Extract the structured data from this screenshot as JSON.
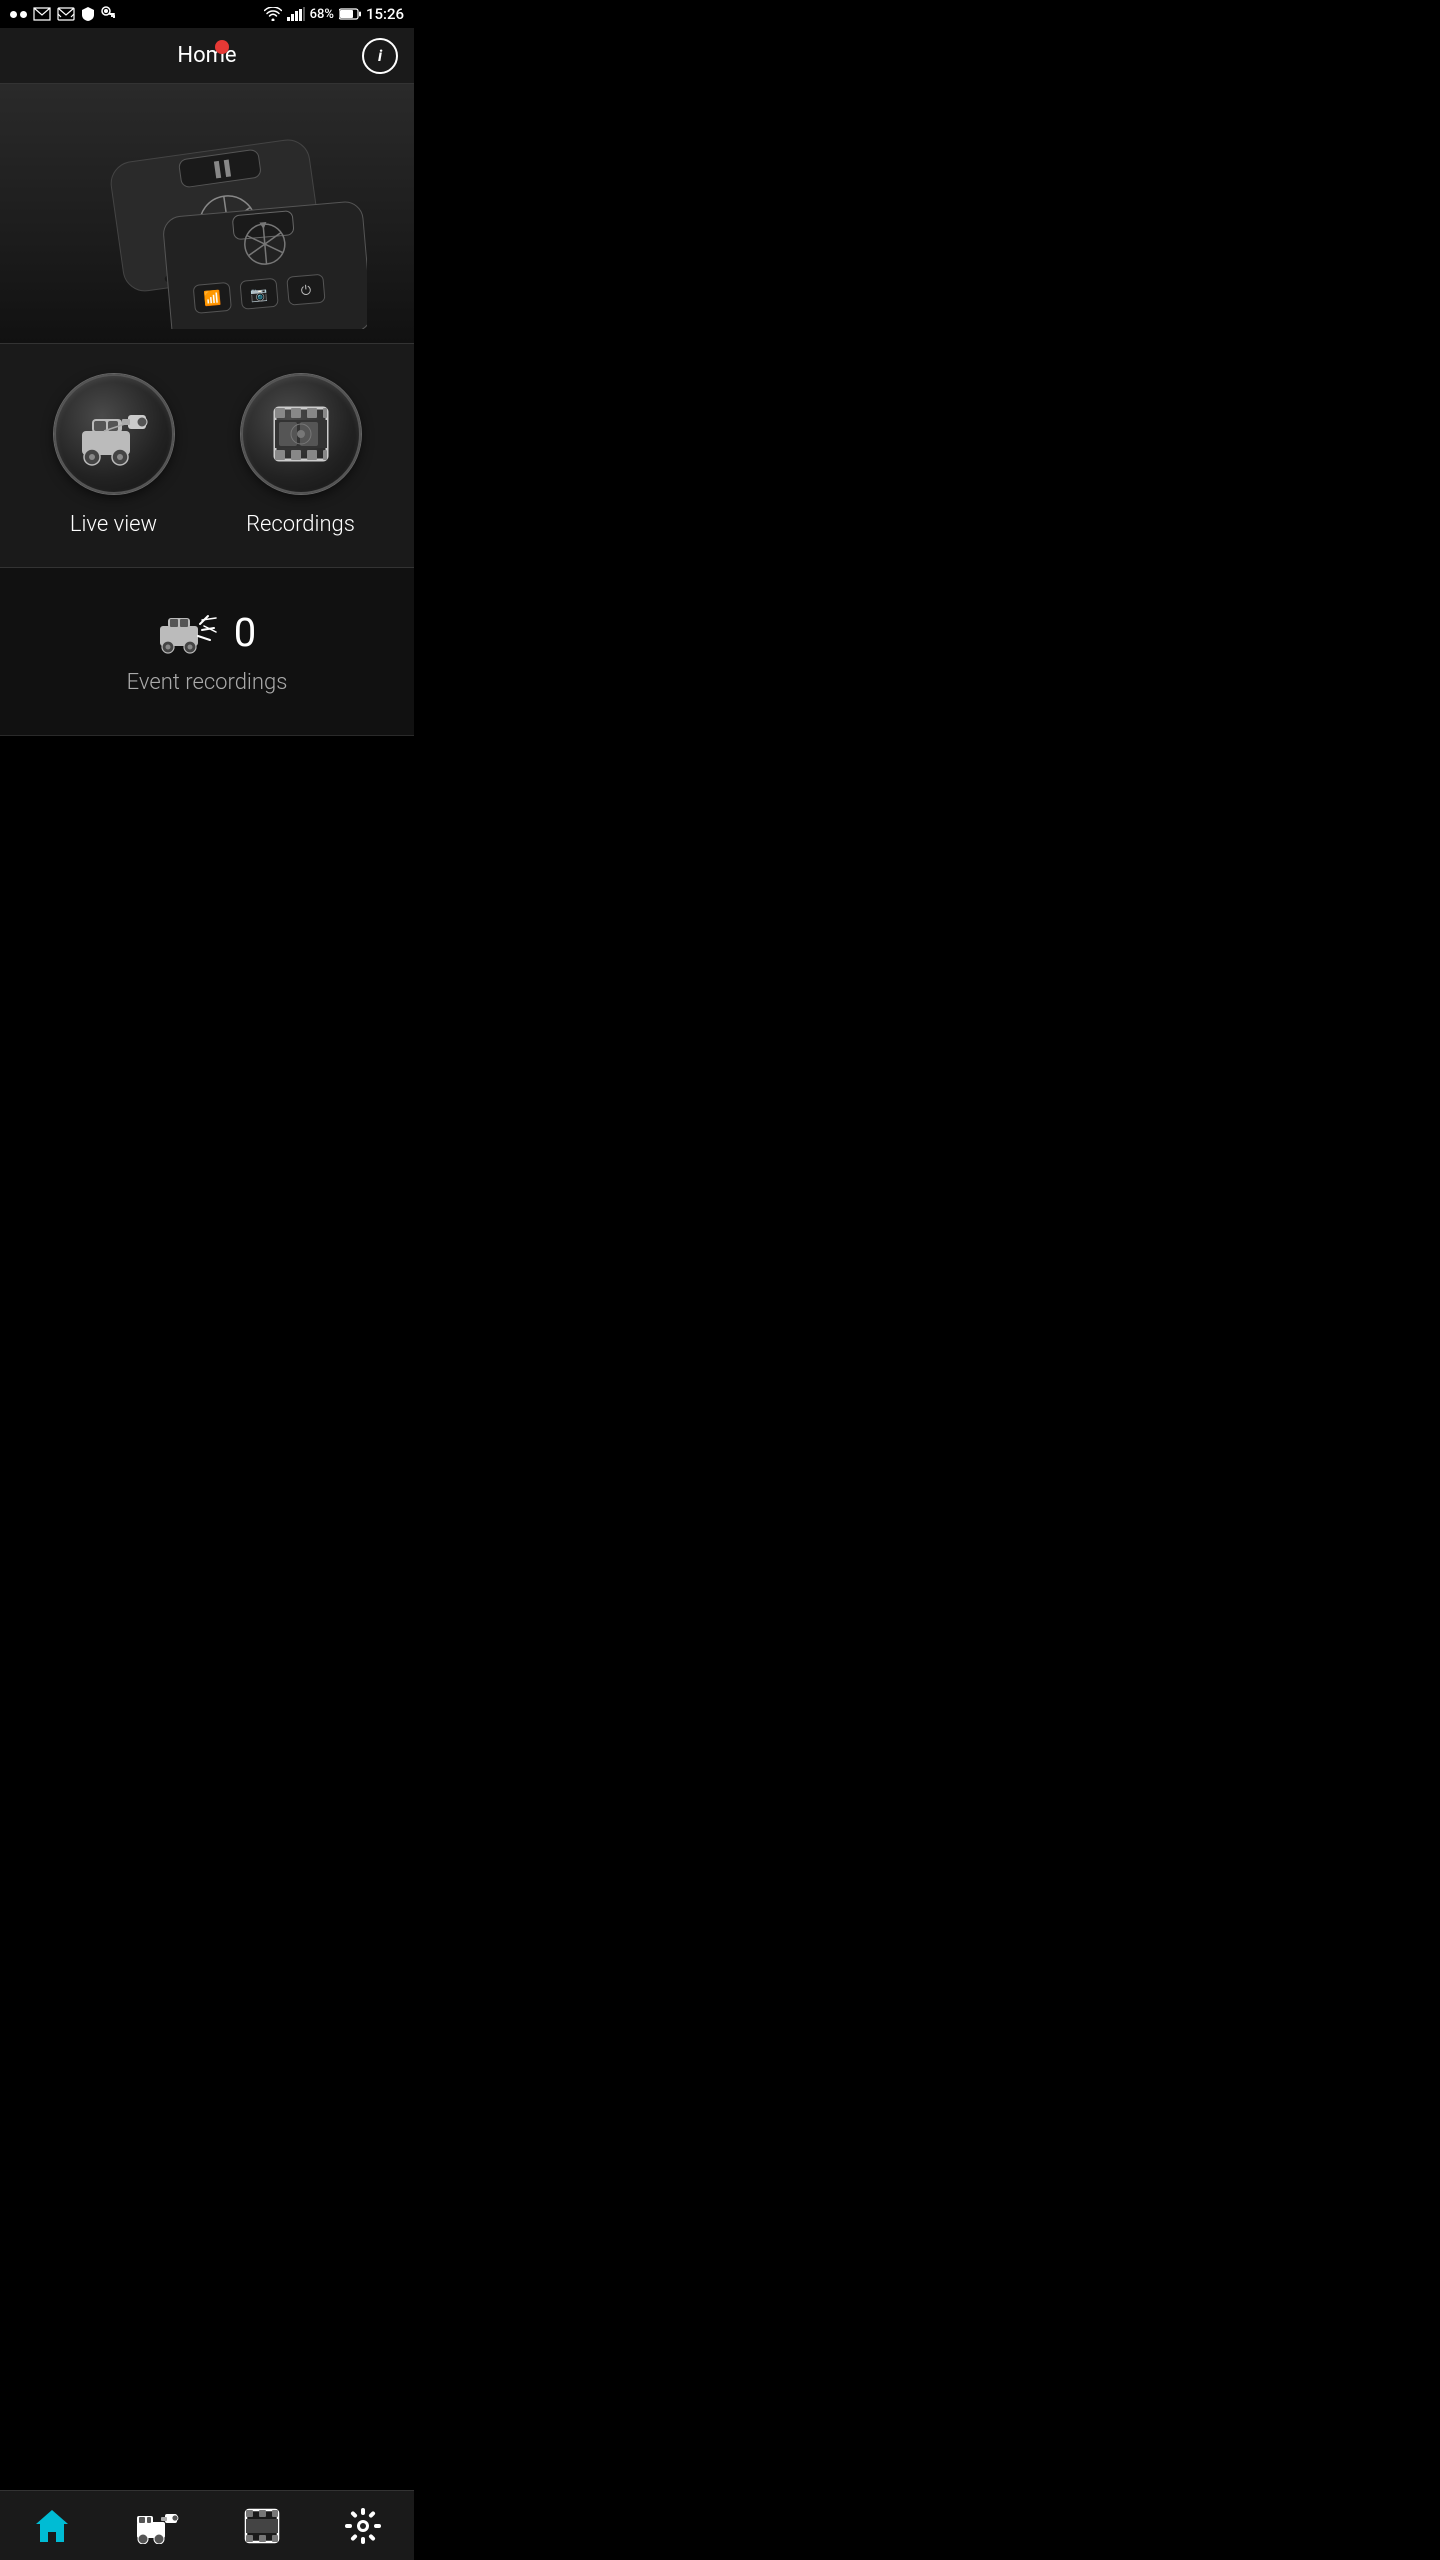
{
  "statusBar": {
    "battery": "68%",
    "time": "15:26",
    "wifiLabel": "wifi",
    "signalLabel": "signal"
  },
  "header": {
    "title": "Home",
    "infoIcon": "i"
  },
  "actions": {
    "liveView": {
      "label": "Live view",
      "iconName": "camera-car-icon"
    },
    "recordings": {
      "label": "Recordings",
      "iconName": "film-reel-icon"
    }
  },
  "event": {
    "count": "0",
    "label": "Event recordings",
    "iconName": "car-crash-icon"
  },
  "nav": {
    "home": "Home",
    "liveView": "Live view",
    "recordings": "Recordings",
    "settings": "Settings"
  }
}
